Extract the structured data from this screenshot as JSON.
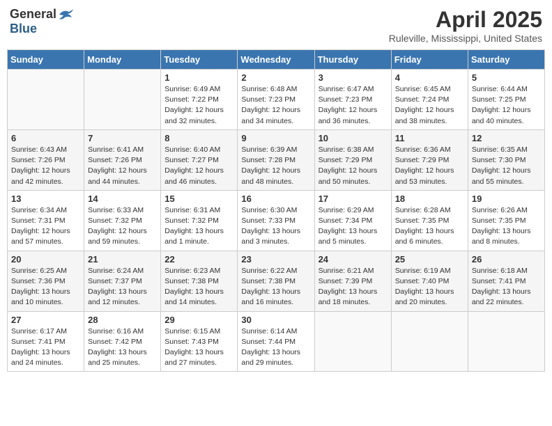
{
  "logo": {
    "general": "General",
    "blue": "Blue"
  },
  "title": "April 2025",
  "subtitle": "Ruleville, Mississippi, United States",
  "weekdays": [
    "Sunday",
    "Monday",
    "Tuesday",
    "Wednesday",
    "Thursday",
    "Friday",
    "Saturday"
  ],
  "weeks": [
    [
      {
        "day": "",
        "info": ""
      },
      {
        "day": "",
        "info": ""
      },
      {
        "day": "1",
        "info": "Sunrise: 6:49 AM\nSunset: 7:22 PM\nDaylight: 12 hours\nand 32 minutes."
      },
      {
        "day": "2",
        "info": "Sunrise: 6:48 AM\nSunset: 7:23 PM\nDaylight: 12 hours\nand 34 minutes."
      },
      {
        "day": "3",
        "info": "Sunrise: 6:47 AM\nSunset: 7:23 PM\nDaylight: 12 hours\nand 36 minutes."
      },
      {
        "day": "4",
        "info": "Sunrise: 6:45 AM\nSunset: 7:24 PM\nDaylight: 12 hours\nand 38 minutes."
      },
      {
        "day": "5",
        "info": "Sunrise: 6:44 AM\nSunset: 7:25 PM\nDaylight: 12 hours\nand 40 minutes."
      }
    ],
    [
      {
        "day": "6",
        "info": "Sunrise: 6:43 AM\nSunset: 7:26 PM\nDaylight: 12 hours\nand 42 minutes."
      },
      {
        "day": "7",
        "info": "Sunrise: 6:41 AM\nSunset: 7:26 PM\nDaylight: 12 hours\nand 44 minutes."
      },
      {
        "day": "8",
        "info": "Sunrise: 6:40 AM\nSunset: 7:27 PM\nDaylight: 12 hours\nand 46 minutes."
      },
      {
        "day": "9",
        "info": "Sunrise: 6:39 AM\nSunset: 7:28 PM\nDaylight: 12 hours\nand 48 minutes."
      },
      {
        "day": "10",
        "info": "Sunrise: 6:38 AM\nSunset: 7:29 PM\nDaylight: 12 hours\nand 50 minutes."
      },
      {
        "day": "11",
        "info": "Sunrise: 6:36 AM\nSunset: 7:29 PM\nDaylight: 12 hours\nand 53 minutes."
      },
      {
        "day": "12",
        "info": "Sunrise: 6:35 AM\nSunset: 7:30 PM\nDaylight: 12 hours\nand 55 minutes."
      }
    ],
    [
      {
        "day": "13",
        "info": "Sunrise: 6:34 AM\nSunset: 7:31 PM\nDaylight: 12 hours\nand 57 minutes."
      },
      {
        "day": "14",
        "info": "Sunrise: 6:33 AM\nSunset: 7:32 PM\nDaylight: 12 hours\nand 59 minutes."
      },
      {
        "day": "15",
        "info": "Sunrise: 6:31 AM\nSunset: 7:32 PM\nDaylight: 13 hours\nand 1 minute."
      },
      {
        "day": "16",
        "info": "Sunrise: 6:30 AM\nSunset: 7:33 PM\nDaylight: 13 hours\nand 3 minutes."
      },
      {
        "day": "17",
        "info": "Sunrise: 6:29 AM\nSunset: 7:34 PM\nDaylight: 13 hours\nand 5 minutes."
      },
      {
        "day": "18",
        "info": "Sunrise: 6:28 AM\nSunset: 7:35 PM\nDaylight: 13 hours\nand 6 minutes."
      },
      {
        "day": "19",
        "info": "Sunrise: 6:26 AM\nSunset: 7:35 PM\nDaylight: 13 hours\nand 8 minutes."
      }
    ],
    [
      {
        "day": "20",
        "info": "Sunrise: 6:25 AM\nSunset: 7:36 PM\nDaylight: 13 hours\nand 10 minutes."
      },
      {
        "day": "21",
        "info": "Sunrise: 6:24 AM\nSunset: 7:37 PM\nDaylight: 13 hours\nand 12 minutes."
      },
      {
        "day": "22",
        "info": "Sunrise: 6:23 AM\nSunset: 7:38 PM\nDaylight: 13 hours\nand 14 minutes."
      },
      {
        "day": "23",
        "info": "Sunrise: 6:22 AM\nSunset: 7:38 PM\nDaylight: 13 hours\nand 16 minutes."
      },
      {
        "day": "24",
        "info": "Sunrise: 6:21 AM\nSunset: 7:39 PM\nDaylight: 13 hours\nand 18 minutes."
      },
      {
        "day": "25",
        "info": "Sunrise: 6:19 AM\nSunset: 7:40 PM\nDaylight: 13 hours\nand 20 minutes."
      },
      {
        "day": "26",
        "info": "Sunrise: 6:18 AM\nSunset: 7:41 PM\nDaylight: 13 hours\nand 22 minutes."
      }
    ],
    [
      {
        "day": "27",
        "info": "Sunrise: 6:17 AM\nSunset: 7:41 PM\nDaylight: 13 hours\nand 24 minutes."
      },
      {
        "day": "28",
        "info": "Sunrise: 6:16 AM\nSunset: 7:42 PM\nDaylight: 13 hours\nand 25 minutes."
      },
      {
        "day": "29",
        "info": "Sunrise: 6:15 AM\nSunset: 7:43 PM\nDaylight: 13 hours\nand 27 minutes."
      },
      {
        "day": "30",
        "info": "Sunrise: 6:14 AM\nSunset: 7:44 PM\nDaylight: 13 hours\nand 29 minutes."
      },
      {
        "day": "",
        "info": ""
      },
      {
        "day": "",
        "info": ""
      },
      {
        "day": "",
        "info": ""
      }
    ]
  ]
}
